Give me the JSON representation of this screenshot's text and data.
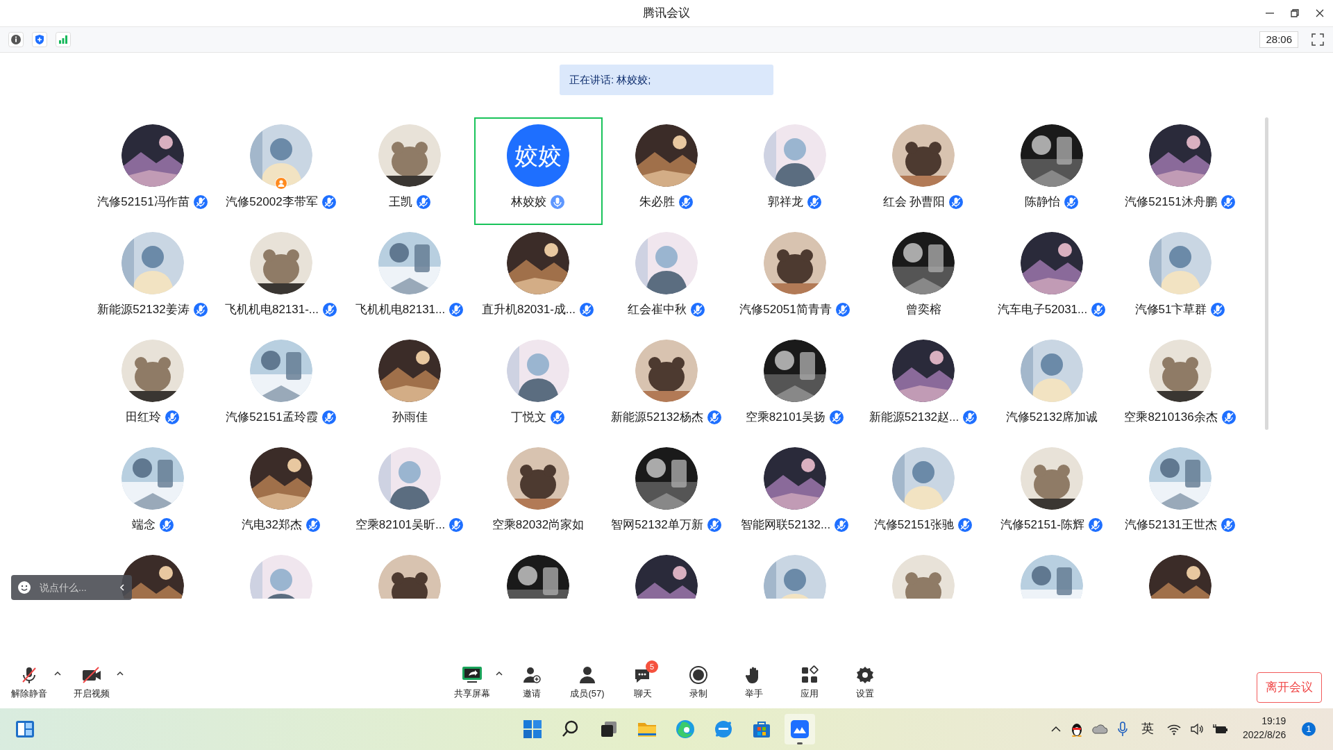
{
  "window": {
    "title": "腾讯会议"
  },
  "info_bar": {
    "timer": "28:06"
  },
  "speaking_banner": "正在讲话: 林姣姣;",
  "participants": [
    {
      "name": "汽修52151冯作苗",
      "kind": "picture",
      "mic_muted": true,
      "selected": false
    },
    {
      "name": "汽修52002李带军",
      "kind": "picture",
      "mic_muted": true,
      "selected": false,
      "host": true
    },
    {
      "name": "王凯",
      "kind": "picture",
      "mic_muted": true,
      "selected": false
    },
    {
      "name": "林姣姣",
      "kind": "text",
      "avatar_text": "姣姣",
      "mic_muted": false,
      "selected": true
    },
    {
      "name": "朱必胜",
      "kind": "picture",
      "mic_muted": true,
      "selected": false
    },
    {
      "name": "郭祥龙",
      "kind": "picture",
      "mic_muted": true,
      "selected": false
    },
    {
      "name": "红会 孙曹阳",
      "kind": "picture",
      "mic_muted": true,
      "selected": false
    },
    {
      "name": "陈静怡",
      "kind": "picture",
      "mic_muted": true,
      "selected": false
    },
    {
      "name": "汽修52151沐舟鹏",
      "kind": "picture",
      "mic_muted": true,
      "selected": false
    },
    {
      "name": "新能源52132姜涛",
      "kind": "picture",
      "mic_muted": true,
      "selected": false
    },
    {
      "name": "飞机机电82131-...",
      "kind": "picture",
      "mic_muted": true,
      "selected": false
    },
    {
      "name": "飞机机电82131...",
      "kind": "picture",
      "mic_muted": true,
      "selected": false
    },
    {
      "name": "直升机82031-成...",
      "kind": "picture",
      "mic_muted": true,
      "selected": false
    },
    {
      "name": "红会崔中秋",
      "kind": "picture",
      "mic_muted": true,
      "selected": false
    },
    {
      "name": "汽修52051简青青",
      "kind": "picture",
      "mic_muted": true,
      "selected": false
    },
    {
      "name": "曾奕榕",
      "kind": "picture",
      "selected": false
    },
    {
      "name": "汽车电子52031...",
      "kind": "picture",
      "mic_muted": true,
      "selected": false
    },
    {
      "name": "汽修51卞草群",
      "kind": "picture",
      "mic_muted": true,
      "selected": false
    },
    {
      "name": "田红玲",
      "kind": "picture",
      "mic_muted": true,
      "selected": false
    },
    {
      "name": "汽修52151孟玲霞",
      "kind": "picture",
      "mic_muted": true,
      "selected": false
    },
    {
      "name": "孙雨佳",
      "kind": "picture",
      "selected": false
    },
    {
      "name": "丁悦文",
      "kind": "picture",
      "mic_muted": true,
      "selected": false
    },
    {
      "name": "新能源52132杨杰",
      "kind": "picture",
      "mic_muted": true,
      "selected": false
    },
    {
      "name": "空乘82101吴扬",
      "kind": "picture",
      "mic_muted": true,
      "selected": false
    },
    {
      "name": "新能源52132赵...",
      "kind": "picture",
      "mic_muted": true,
      "selected": false
    },
    {
      "name": "汽修52132席加诚",
      "kind": "picture",
      "selected": false
    },
    {
      "name": "空乘8210136余杰",
      "kind": "picture",
      "mic_muted": true,
      "selected": false
    },
    {
      "name": "端念",
      "kind": "picture",
      "mic_muted": true,
      "selected": false
    },
    {
      "name": "汽电32郑杰",
      "kind": "picture",
      "mic_muted": true,
      "selected": false
    },
    {
      "name": "空乘82101吴昕...",
      "kind": "picture",
      "mic_muted": true,
      "selected": false
    },
    {
      "name": "空乘82032尚家如",
      "kind": "picture",
      "selected": false
    },
    {
      "name": "智网52132单万新",
      "kind": "picture",
      "mic_muted": true,
      "selected": false
    },
    {
      "name": "智能网联52132...",
      "kind": "picture",
      "mic_muted": true,
      "selected": false
    },
    {
      "name": "汽修52151张驰",
      "kind": "picture",
      "mic_muted": true,
      "selected": false
    },
    {
      "name": "汽修52151-陈辉",
      "kind": "picture",
      "mic_muted": true,
      "selected": false
    },
    {
      "name": "汽修52131王世杰",
      "kind": "picture",
      "mic_muted": true,
      "selected": false
    },
    {
      "kind": "picture",
      "selected": false
    },
    {
      "kind": "picture",
      "selected": false
    },
    {
      "kind": "picture",
      "selected": false
    },
    {
      "kind": "picture",
      "selected": false
    },
    {
      "kind": "picture",
      "selected": false
    },
    {
      "kind": "picture",
      "selected": false
    },
    {
      "kind": "picture",
      "selected": false
    },
    {
      "kind": "picture",
      "selected": false
    },
    {
      "kind": "picture",
      "selected": false
    }
  ],
  "chat_input": {
    "placeholder": "说点什么..."
  },
  "toolbar_left": [
    {
      "label": "解除静音",
      "kind": "unmute",
      "caret": true
    },
    {
      "label": "开启视频",
      "kind": "video",
      "caret": true
    }
  ],
  "toolbar_center": [
    {
      "label": "共享屏幕",
      "kind": "share",
      "caret": true
    },
    {
      "label": "邀请",
      "kind": "invite",
      "caret": false
    },
    {
      "label": "成员(57)",
      "kind": "members",
      "caret": false
    },
    {
      "label": "聊天",
      "kind": "chat",
      "caret": false,
      "badge": "5"
    },
    {
      "label": "录制",
      "kind": "record",
      "caret": false
    },
    {
      "label": "举手",
      "kind": "hand",
      "caret": false
    },
    {
      "label": "应用",
      "kind": "apps",
      "caret": false
    },
    {
      "label": "设置",
      "kind": "settings",
      "caret": false
    }
  ],
  "leave_button": "离开会议",
  "taskbar": {
    "apps": [
      {
        "kind": "start",
        "active": false
      },
      {
        "kind": "search",
        "active": false
      },
      {
        "kind": "taskview",
        "active": false
      },
      {
        "kind": "folder",
        "active": false
      },
      {
        "kind": "edge",
        "active": false
      },
      {
        "kind": "ie",
        "active": false
      },
      {
        "kind": "store",
        "active": false
      },
      {
        "kind": "meeting",
        "active": true
      }
    ],
    "ime": "英",
    "time": "19:19",
    "date": "2022/8/26",
    "notifications": "1"
  }
}
